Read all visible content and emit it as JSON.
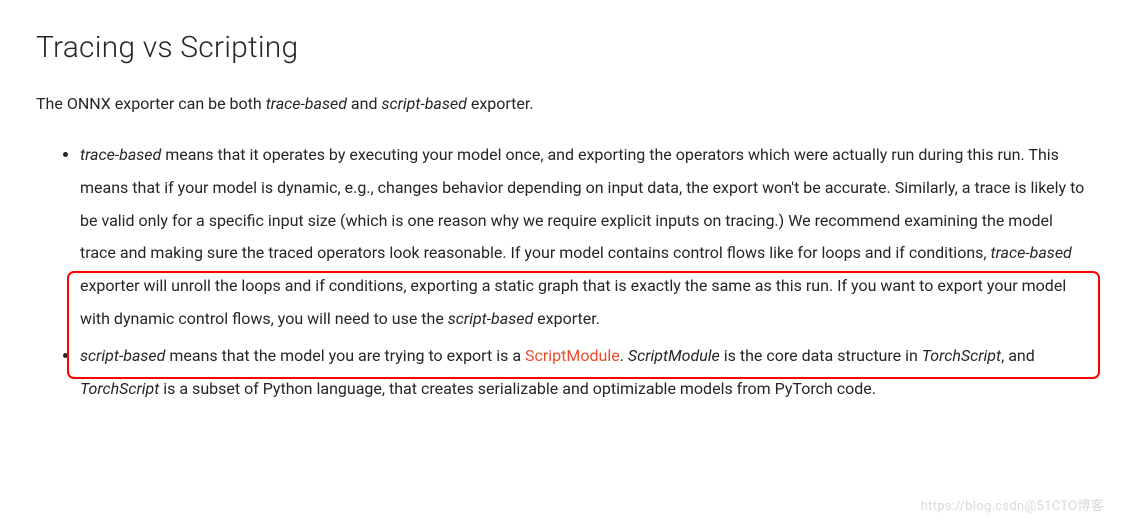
{
  "heading": "Tracing vs Scripting",
  "intro": {
    "pre": "The ONNX exporter can be both ",
    "em1": "trace-based",
    "mid": " and ",
    "em2": "script-based",
    "post": " exporter."
  },
  "bullet1": {
    "em1": "trace-based",
    "t1": " means that it operates by executing your model once, and exporting the operators which were actually run during this run. This means that if your model is dynamic, e.g., changes behavior depending on input data, the export won't be accurate. Similarly, a trace is likely to be valid only for a specific input size (which is one reason why we require explicit inputs on tracing.) We recommend examining the model trace and making sure the traced operators look reasonable. If your model contains control flows like for loops and if conditions, ",
    "em2": "trace-based",
    "t2": " exporter will unroll the loops and if conditions, exporting a static graph that is exactly the same as this run. If you want to export your model with dynamic control flows, you will need to use the ",
    "em3": "script-based",
    "t3": " exporter."
  },
  "bullet2": {
    "em1": "script-based",
    "t1": " means that the model you are trying to export is a ",
    "link": "ScriptModule",
    "t2": ". ",
    "em2": "ScriptModule",
    "t3": " is the core data structure in ",
    "em3": "TorchScript",
    "t4": ", and ",
    "em4": "TorchScript",
    "t5": " is a subset of Python language, that creates serializable and optimizable models from PyTorch code."
  },
  "watermark": "https://blog.csdn@51CTO博客"
}
